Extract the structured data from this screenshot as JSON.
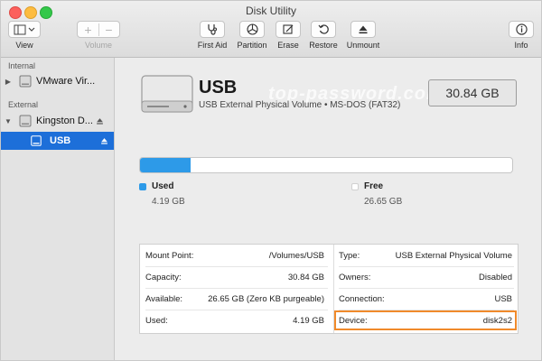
{
  "window": {
    "title": "Disk Utility"
  },
  "toolbar": {
    "view_label": "View",
    "volume_label": "Volume",
    "first_aid_label": "First Aid",
    "partition_label": "Partition",
    "erase_label": "Erase",
    "restore_label": "Restore",
    "unmount_label": "Unmount",
    "info_label": "Info"
  },
  "sidebar": {
    "sections": [
      {
        "title": "Internal",
        "items": [
          {
            "label": "VMware Vir..."
          }
        ]
      },
      {
        "title": "External",
        "items": [
          {
            "label": "Kingston D..."
          },
          {
            "label": "USB",
            "selected": true
          }
        ]
      }
    ]
  },
  "volume": {
    "name": "USB",
    "description": "USB External Physical Volume • MS-DOS (FAT32)",
    "size": "30.84 GB",
    "watermark": "top-password.com"
  },
  "usage": {
    "used_fraction": 0.136,
    "used_title": "Used",
    "used_value": "4.19 GB",
    "free_title": "Free",
    "free_value": "26.65 GB",
    "used_color": "#2d9ae8",
    "free_color": "#ffffff"
  },
  "info": {
    "left": [
      {
        "key": "Mount Point:",
        "value": "/Volumes/USB"
      },
      {
        "key": "Capacity:",
        "value": "30.84 GB"
      },
      {
        "key": "Available:",
        "value": "26.65 GB (Zero KB purgeable)"
      },
      {
        "key": "Used:",
        "value": "4.19 GB"
      }
    ],
    "right": [
      {
        "key": "Type:",
        "value": "USB External Physical Volume"
      },
      {
        "key": "Owners:",
        "value": "Disabled"
      },
      {
        "key": "Connection:",
        "value": "USB"
      },
      {
        "key": "Device:",
        "value": "disk2s2"
      }
    ],
    "highlight_color": "#f08a2b"
  }
}
